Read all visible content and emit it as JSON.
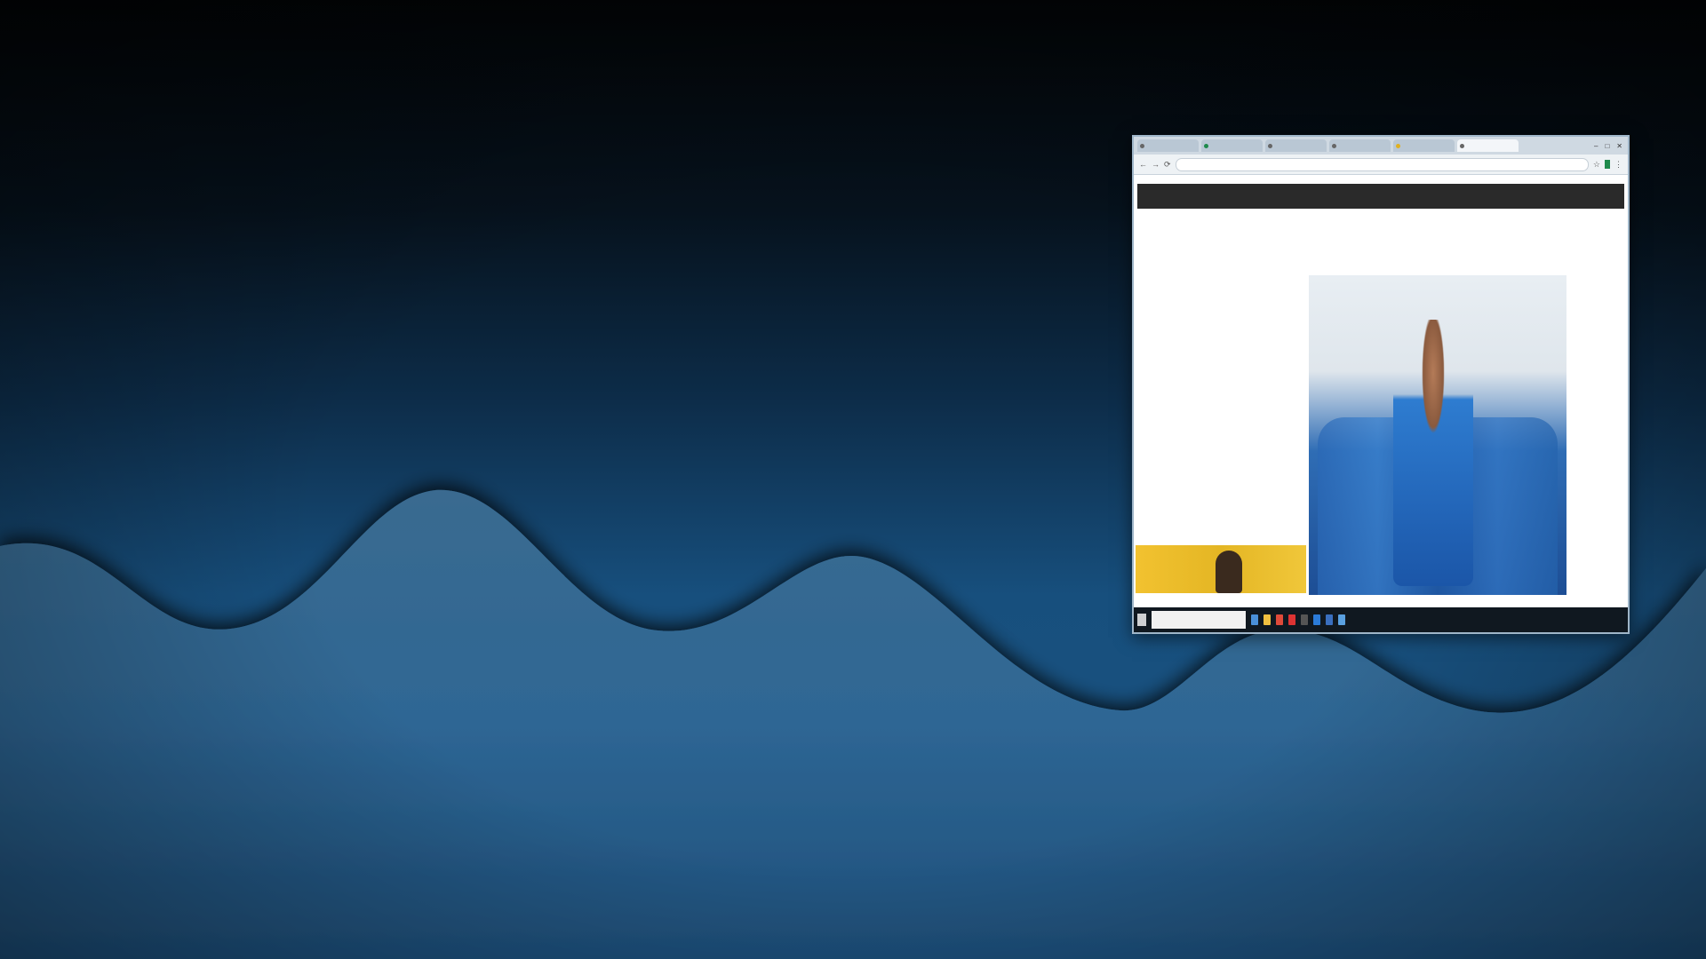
{
  "background": {
    "gradient_top": "#020406",
    "gradient_bottom": "#1b5482",
    "wave_fill": "#2f6b99"
  },
  "thumbnail": {
    "tabs": [
      {
        "label": "",
        "icon": "page-icon"
      },
      {
        "label": "",
        "icon": "sheet-icon"
      },
      {
        "label": "",
        "icon": "page-icon"
      },
      {
        "label": "",
        "icon": "page-icon"
      },
      {
        "label": "",
        "icon": "page-icon"
      },
      {
        "label": "",
        "icon": "page-icon"
      }
    ],
    "url": "",
    "site_nav": [
      "",
      "",
      ""
    ],
    "headline": "",
    "subtext": "",
    "poster": {
      "logo_text": "",
      "brand_text": ""
    },
    "taskbar": {
      "search_placeholder": "",
      "tray_text": ""
    }
  }
}
